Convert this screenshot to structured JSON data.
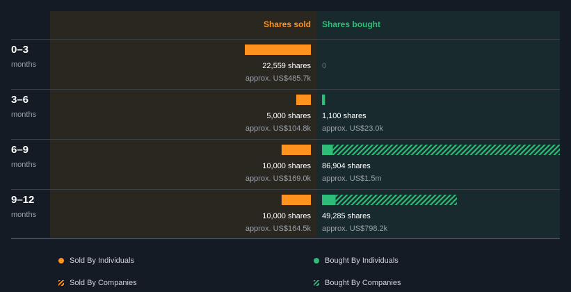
{
  "colors": {
    "sold": "#ff931e",
    "bought": "#2ebd78",
    "sold_panel": "#2a2620",
    "bought_panel": "#182a2d",
    "background": "#151b24",
    "muted": "#9aa1a9",
    "divider": "#3a4048"
  },
  "header": {
    "sold_label": "Shares sold",
    "bought_label": "Shares bought"
  },
  "chart_data": {
    "type": "bar",
    "categories": [
      "0–3",
      "3–6",
      "6–9",
      "9–12"
    ],
    "category_unit": "months",
    "series": [
      {
        "name": "Sold By Individuals",
        "values": [
          22559,
          5000,
          10000,
          10000
        ]
      },
      {
        "name": "Sold By Companies",
        "values": [
          0,
          0,
          0,
          0
        ]
      },
      {
        "name": "Bought By Individuals",
        "values": [
          0,
          1100,
          4000,
          5000
        ]
      },
      {
        "name": "Bought By Companies",
        "values": [
          0,
          0,
          82904,
          44285
        ]
      }
    ],
    "sold_labels": [
      "22,559 shares",
      "5,000 shares",
      "10,000 shares",
      "10,000 shares"
    ],
    "sold_values_label": [
      "approx. US$485.7k",
      "approx. US$104.8k",
      "approx. US$169.0k",
      "approx. US$164.5k"
    ],
    "bought_labels": [
      "0",
      "1,100 shares",
      "86,904 shares",
      "49,285 shares"
    ],
    "bought_values_label": [
      "",
      "approx. US$23.0k",
      "approx. US$1.5m",
      "approx. US$798.2k"
    ]
  },
  "legend": [
    {
      "label": "Sold By Individuals",
      "style": "dot",
      "color": "#ff931e"
    },
    {
      "label": "Bought By Individuals",
      "style": "dot",
      "color": "#2ebd78"
    },
    {
      "label": "Sold By Companies",
      "style": "hatch",
      "color": "#ff931e"
    },
    {
      "label": "Bought By Companies",
      "style": "hatch",
      "color": "#2ebd78"
    }
  ]
}
